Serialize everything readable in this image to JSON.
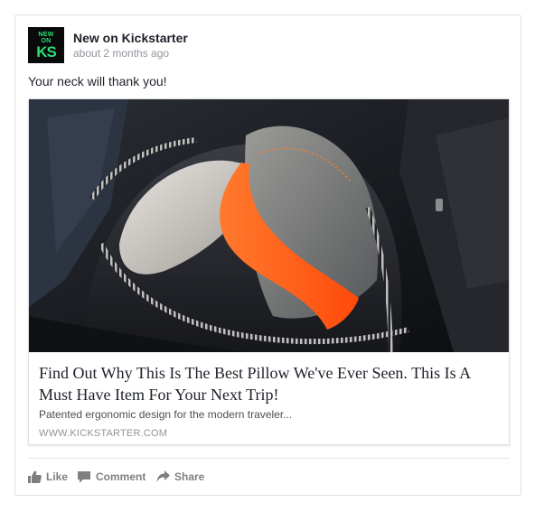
{
  "post": {
    "page_name": "New on Kickstarter",
    "timestamp": "about 2 months ago",
    "text": "Your neck will thank you!",
    "avatar": {
      "line1": "NEW",
      "line2": "ON",
      "line3": "KS",
      "background": "#0a0a0a",
      "accent": "#2bde73"
    },
    "link_card": {
      "image": "photo of an open dark backpack with an orange and grey travel pillow inside",
      "title": "Find Out Why This Is The Best Pillow We've Ever Seen. This Is A Must Have Item For Your Next Trip!",
      "description": "Patented ergonomic design for the modern traveler...",
      "domain": "WWW.KICKSTARTER.COM"
    },
    "actions": {
      "like": {
        "label": "Like",
        "icon": "thumbs-up-icon"
      },
      "comment": {
        "label": "Comment",
        "icon": "speech-bubble-icon"
      },
      "share": {
        "label": "Share",
        "icon": "share-arrow-icon"
      }
    }
  },
  "colors": {
    "text_primary": "#1d2129",
    "text_secondary": "#90949c",
    "action_text": "#7f7f7f",
    "accent_orange": "#ff5a1a"
  }
}
